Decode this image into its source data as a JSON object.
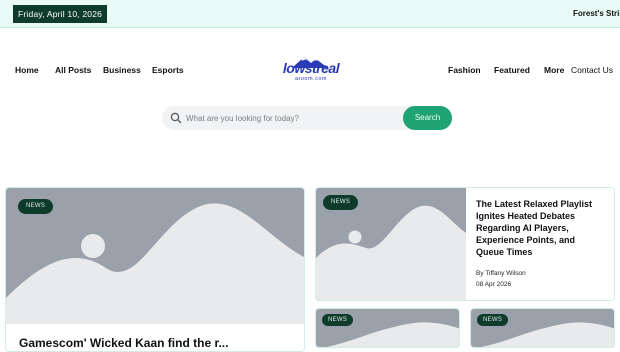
{
  "topbar": {
    "date": "Friday, April 10, 2026",
    "ticker": "Forest's Strike"
  },
  "nav": {
    "left": [
      "Home",
      "All Posts",
      "Business",
      "Esports"
    ],
    "right": [
      "Fashion",
      "Featured",
      "More",
      "Contact Us"
    ]
  },
  "logo": {
    "name": "lowstreal",
    "sub": "aroom.com"
  },
  "search": {
    "placeholder": "What are you looking for today?",
    "button": "Search"
  },
  "cards": {
    "main": {
      "tag": "NEWS",
      "title": "Gamescom' Wicked Kaan find the r..."
    },
    "featured": {
      "tag": "NEWS",
      "title": "The Latest Relaxed Playlist Ignites Heated Debates Regarding AI Players, Experience Points, and Queue Times",
      "author": "By Tiffany Wilson",
      "date": "08 Apr 2026"
    },
    "small1": {
      "tag": "NEWS"
    },
    "small2": {
      "tag": "NEWS"
    }
  },
  "colors": {
    "accent": "#1fa374",
    "dark_badge": "#0f3b2c",
    "topbar_bg": "#e8fbf6",
    "placeholder": "#9aa1aa"
  },
  "icons": {
    "search": "search-icon"
  }
}
